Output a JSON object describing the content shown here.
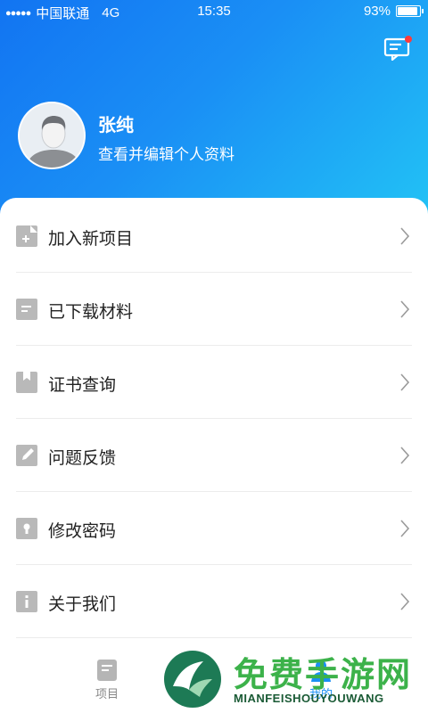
{
  "status_bar": {
    "signal_dots": "●●●●●",
    "carrier": "中国联通",
    "network": "4G",
    "time": "15:35",
    "battery_text": "93%",
    "battery_level": 0.93
  },
  "header": {
    "message_icon": "message-notification-icon",
    "user_name": "张纯",
    "subtitle": "查看并编辑个人资料"
  },
  "menu": {
    "items": [
      {
        "label": "加入新项目",
        "icon": "add-file-icon"
      },
      {
        "label": "已下载材料",
        "icon": "document-icon"
      },
      {
        "label": "证书查询",
        "icon": "certificate-icon"
      },
      {
        "label": "问题反馈",
        "icon": "edit-icon"
      },
      {
        "label": "修改密码",
        "icon": "lock-icon"
      },
      {
        "label": "关于我们",
        "icon": "info-icon"
      }
    ]
  },
  "tabbar": {
    "tabs": [
      {
        "label": "项目",
        "icon": "project-icon",
        "active": false
      },
      {
        "label": "我的",
        "icon": "user-icon",
        "active": true
      }
    ]
  },
  "watermark": {
    "title": "免费手游网",
    "subtitle": "MIANFEISHOUYOUWANG"
  },
  "colors": {
    "header_start": "#1274f2",
    "header_end": "#22c3f5",
    "accent": "#1a8ff5",
    "icon_gray": "#b9b9b9"
  }
}
